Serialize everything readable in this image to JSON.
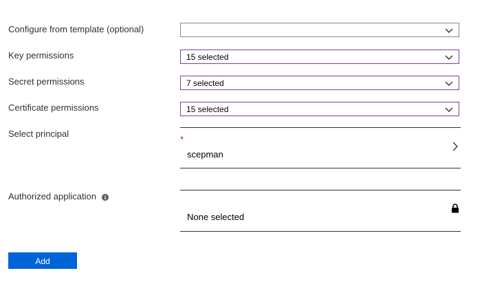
{
  "form": {
    "template": {
      "label": "Configure from template (optional)",
      "value": ""
    },
    "key_permissions": {
      "label": "Key permissions",
      "value": "15 selected"
    },
    "secret_permissions": {
      "label": "Secret permissions",
      "value": "7 selected"
    },
    "certificate_permissions": {
      "label": "Certificate permissions",
      "value": "15 selected"
    },
    "principal": {
      "label": "Select principal",
      "required_marker": "*",
      "value": "scepman"
    },
    "authorized_application": {
      "label": "Authorized application",
      "value": "None selected"
    },
    "add_button": "Add"
  },
  "icons": {
    "dropdown": "chevron-down-icon",
    "principal": "chevron-right-icon",
    "info": "info-icon",
    "lock": "lock-icon"
  },
  "colors": {
    "accent_border": "#7a3f9b",
    "primary_button": "#0063d8",
    "required": "#a4262c"
  }
}
